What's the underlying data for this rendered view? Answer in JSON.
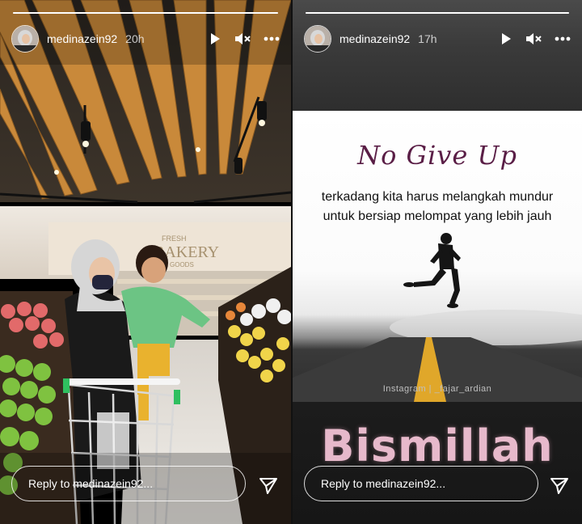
{
  "stories": [
    {
      "username": "medinazein92",
      "time": "20h",
      "progress": 1.0,
      "reply_placeholder": "Reply to medinazein92..."
    },
    {
      "username": "medinazein92",
      "time": "17h",
      "progress": 1.0,
      "reply_placeholder": "Reply to medinazein92...",
      "card": {
        "title": "No Give Up",
        "line1": "terkadang kita harus melangkah mundur",
        "line2": "untuk bersiap melompat yang lebih jauh",
        "credit": "Instagram | _fajar_ardian",
        "caption": "Bismillah"
      }
    }
  ],
  "scene_signs": {
    "fresh": "FRESH",
    "bakery": "BAKERY",
    "goods": "GOODS"
  },
  "icons": {
    "play": "play-icon",
    "mute": "speaker-muted-icon",
    "more": "more-dots-icon",
    "send": "send-icon"
  },
  "colors": {
    "quote_title": "#5a1e46",
    "bismillah": "#e7b9cb",
    "ceiling_wood": "#c9893a"
  }
}
